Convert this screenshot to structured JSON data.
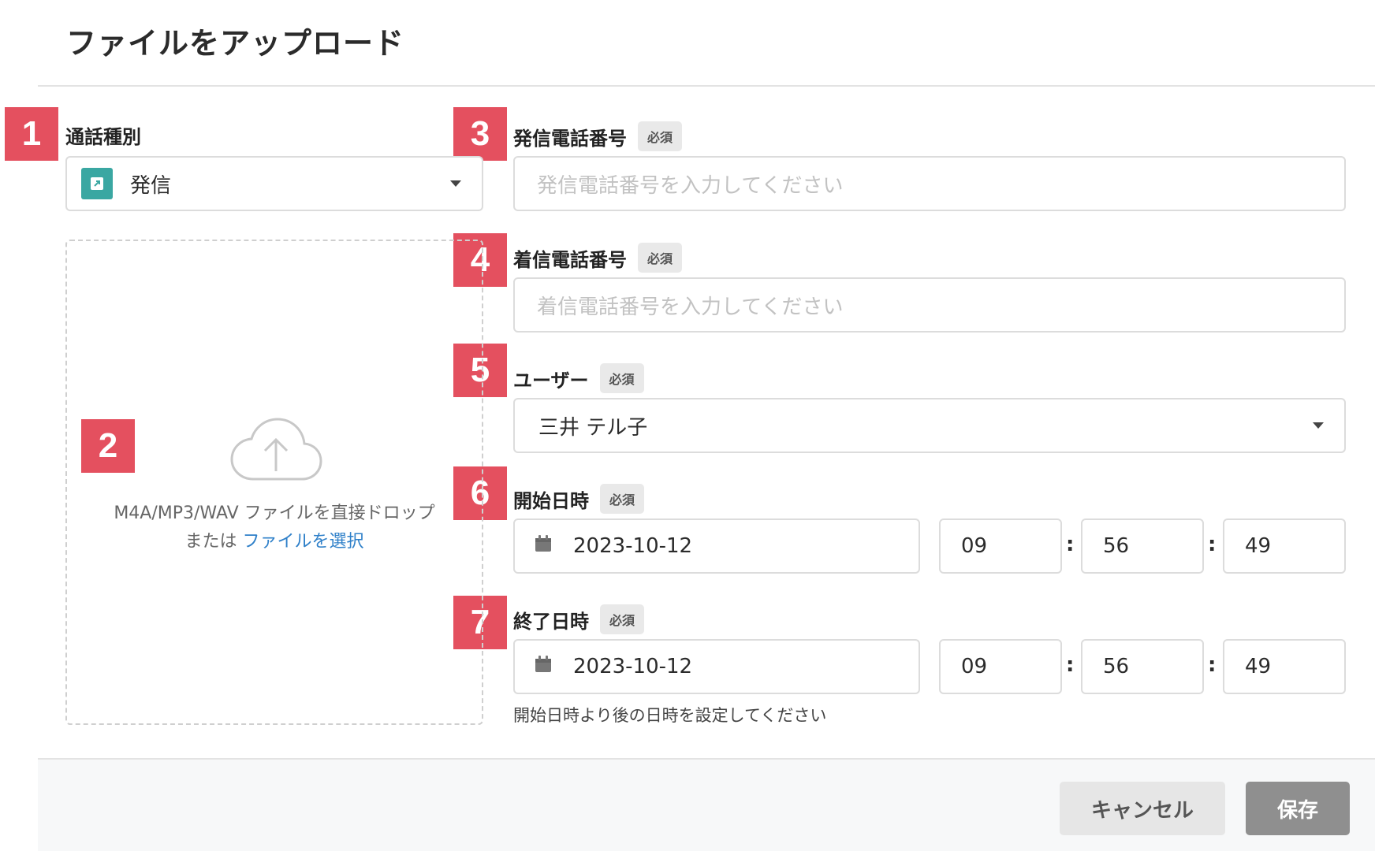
{
  "dialog": {
    "title": "ファイルをアップロード"
  },
  "markers": [
    "1",
    "2",
    "3",
    "4",
    "5",
    "6",
    "7"
  ],
  "required_badge": "必須",
  "call_type": {
    "label": "通話種別",
    "value": "発信",
    "icon": "outgoing-call-icon"
  },
  "dropzone": {
    "text": "M4A/MP3/WAV ファイルを直接ドロップ",
    "or_text": "または",
    "link_text": "ファイルを選択",
    "icon": "cloud-upload-icon"
  },
  "caller_number": {
    "label": "発信電話番号",
    "placeholder": "発信電話番号を入力してください"
  },
  "callee_number": {
    "label": "着信電話番号",
    "placeholder": "着信電話番号を入力してください"
  },
  "user": {
    "label": "ユーザー",
    "value": "三井 テル子"
  },
  "start": {
    "label": "開始日時",
    "date": "2023-10-12",
    "hour": "09",
    "minute": "56",
    "second": "49"
  },
  "end": {
    "label": "終了日時",
    "date": "2023-10-12",
    "hour": "09",
    "minute": "56",
    "second": "49",
    "hint": "開始日時より後の日時を設定してください"
  },
  "time_separator": ":",
  "buttons": {
    "cancel": "キャンセル",
    "save": "保存"
  },
  "colors": {
    "marker": "#e4505f",
    "link": "#2f80c9",
    "call_type_icon": "#3aa7a2",
    "save_button": "#8f8f8f"
  }
}
